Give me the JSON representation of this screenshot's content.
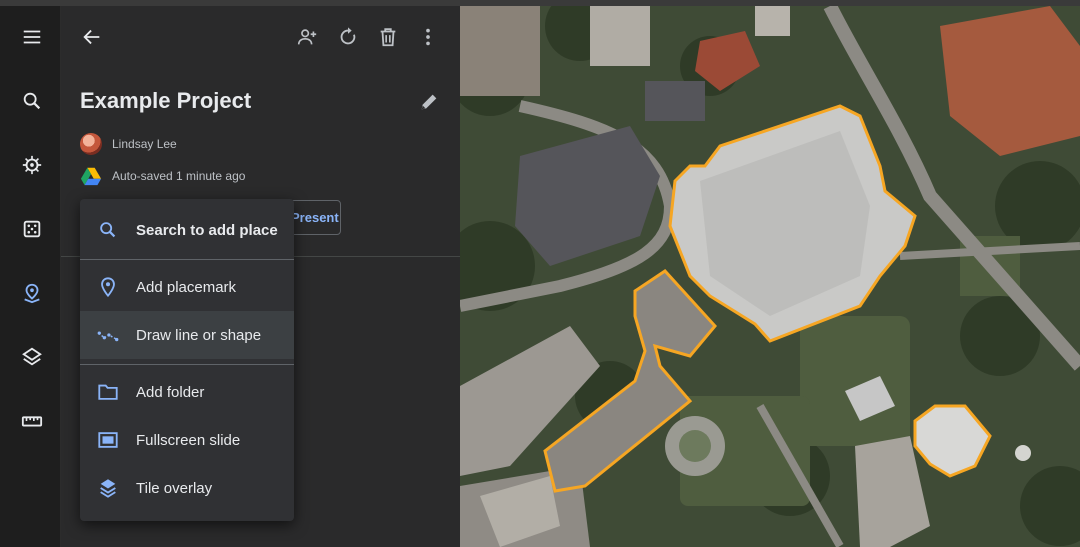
{
  "rail": {
    "items": [
      {
        "name": "menu-icon"
      },
      {
        "name": "search-icon"
      },
      {
        "name": "voyager-icon"
      },
      {
        "name": "feeling-lucky-icon"
      },
      {
        "name": "projects-icon",
        "active": true
      },
      {
        "name": "map-style-icon"
      },
      {
        "name": "measure-icon"
      }
    ]
  },
  "project": {
    "title": "Example Project",
    "owner": "Lindsay Lee",
    "save_status": "Auto-saved 1 minute ago",
    "present_label": "Present",
    "toolbar": [
      "back-icon",
      "share-icon",
      "undo-icon",
      "delete-icon",
      "more-options-icon"
    ]
  },
  "new_menu": {
    "items": [
      {
        "label": "Search to add place",
        "icon": "search-icon"
      },
      {
        "label": "Add placemark",
        "icon": "placemark-icon"
      },
      {
        "label": "Draw line or shape",
        "icon": "draw-line-icon",
        "selected": true
      },
      {
        "label": "Add folder",
        "icon": "folder-icon"
      },
      {
        "label": "Fullscreen slide",
        "icon": "slide-icon"
      },
      {
        "label": "Tile overlay",
        "icon": "tile-overlay-icon"
      }
    ]
  },
  "colors": {
    "accent": "#8ab4f8",
    "outline": "#f6a623",
    "panel": "#2a2a2b",
    "menu": "#303134"
  }
}
